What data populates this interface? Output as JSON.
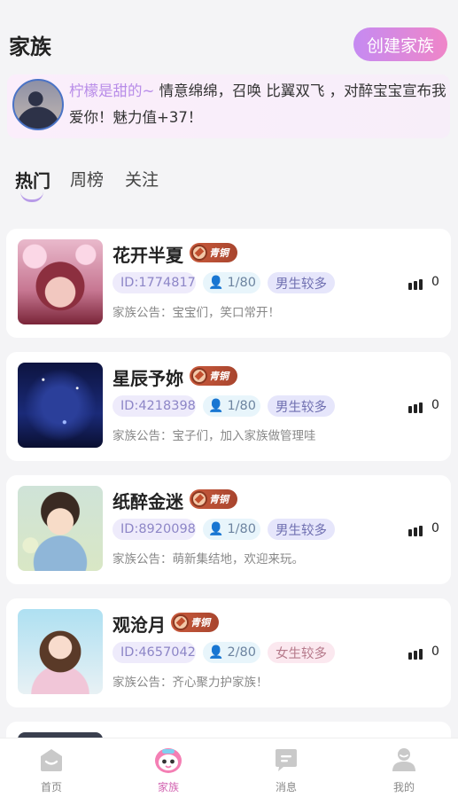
{
  "header": {
    "title": "家族",
    "create_label": "创建家族"
  },
  "broadcast": {
    "user": "柠檬是甜的~",
    "message": " 情意绵绵，召唤 比翼双飞 ，对醉宝宝宣布我爱你！魅力值+37！"
  },
  "tabs": [
    {
      "label": "热门",
      "active": true
    },
    {
      "label": "周榜",
      "active": false
    },
    {
      "label": "关注",
      "active": false
    }
  ],
  "families": [
    {
      "name": "花开半夏",
      "level": "青铜",
      "id": "ID:1774817",
      "members": "1/80",
      "gender": "男生较多",
      "heat": "0",
      "notice": "家族公告：宝宝们，笑口常开！"
    },
    {
      "name": "星辰予妳",
      "level": "青铜",
      "id": "ID:4218398",
      "members": "1/80",
      "gender": "男生较多",
      "heat": "0",
      "notice": "家族公告：宝子们，加入家族做管理哇"
    },
    {
      "name": "纸醉金迷",
      "level": "青铜",
      "id": "ID:8920098",
      "members": "1/80",
      "gender": "男生较多",
      "heat": "0",
      "notice": "家族公告：萌新集结地，欢迎来玩。"
    },
    {
      "name": "观沧月",
      "level": "青铜",
      "id": "ID:4657042",
      "members": "2/80",
      "gender": "女生较多",
      "heat": "0",
      "notice": "家族公告：齐心聚力护家族！"
    }
  ],
  "tabbar": [
    {
      "label": "首页",
      "icon": "home-icon"
    },
    {
      "label": "家族",
      "icon": "family-mascot-icon",
      "active": true
    },
    {
      "label": "消息",
      "icon": "message-icon"
    },
    {
      "label": "我的",
      "icon": "profile-icon"
    }
  ],
  "colors": {
    "accent": "#d264b1",
    "create_gradient_start": "#c58af2",
    "create_gradient_end": "#ef86c8"
  }
}
